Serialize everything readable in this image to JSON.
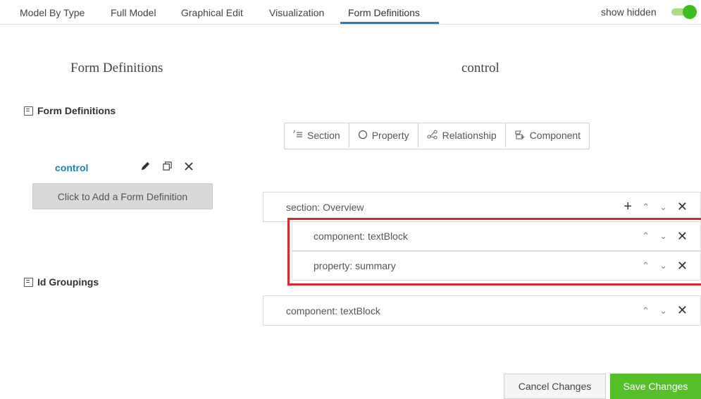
{
  "tabs": [
    {
      "label": "Model By Type"
    },
    {
      "label": "Full Model"
    },
    {
      "label": "Graphical Edit"
    },
    {
      "label": "Visualization"
    },
    {
      "label": "Form Definitions",
      "active": true
    }
  ],
  "toggle": {
    "label": "show hidden",
    "on": true,
    "color": "#3fbd1e"
  },
  "left_panel": {
    "title": "Form Definitions",
    "section_header": "Form Definitions",
    "item": {
      "name": "control"
    },
    "add_button": "Click to Add a Form Definition",
    "groupings_header": "Id Groupings"
  },
  "right_panel": {
    "title": "control",
    "element_buttons": [
      {
        "label": "Section",
        "icon": "list-indent-icon"
      },
      {
        "label": "Property",
        "icon": "circle-icon"
      },
      {
        "label": "Relationship",
        "icon": "relationship-icon"
      },
      {
        "label": "Component",
        "icon": "component-icon"
      }
    ],
    "rows": [
      {
        "label": "section: Overview"
      },
      {
        "label": "component: textBlock"
      },
      {
        "label": "property: summary"
      },
      {
        "label": "component: textBlock"
      }
    ]
  },
  "footer": {
    "cancel": "Cancel Changes",
    "save": "Save Changes"
  },
  "colors": {
    "accent": "#1f7fc0",
    "save": "#55c02a",
    "highlight": "#d9272e"
  }
}
